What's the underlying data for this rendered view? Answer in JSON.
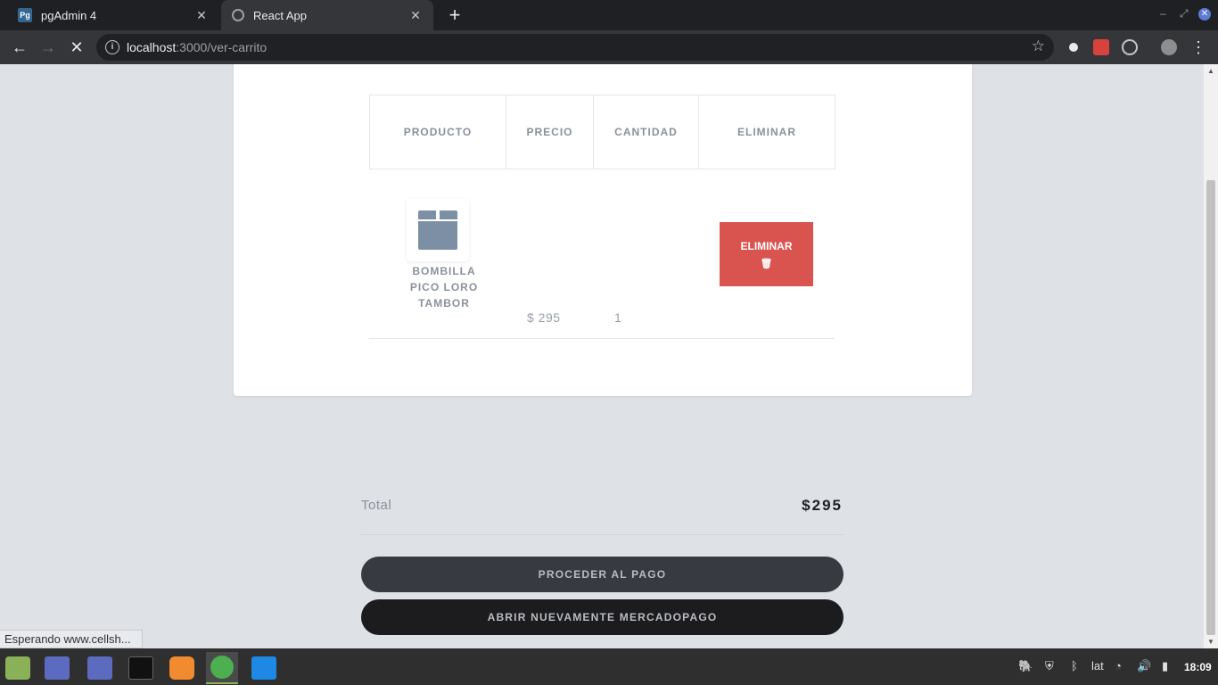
{
  "browser": {
    "tabs": [
      {
        "title": "pgAdmin 4",
        "favicon": "Pg"
      },
      {
        "title": "React App"
      }
    ],
    "url_host": "localhost",
    "url_path": ":3000/ver-carrito"
  },
  "cart": {
    "headers": [
      "PRODUCTO",
      "PRECIO",
      "CANTIDAD",
      "ELIMINAR"
    ],
    "item": {
      "name": "BOMBILLA PICO LORO TAMBOR",
      "price": "$ 295",
      "quantity": "1",
      "delete_label": "ELIMINAR"
    }
  },
  "summary": {
    "total_label": "Total",
    "total_value": "$295",
    "pay_label": "PROCEDER AL PAGO",
    "mercadopago_label": "ABRIR NUEVAMENTE MERCADOPAGO"
  },
  "status_text": "Esperando www.cellsh...",
  "taskbar": {
    "keyboard_layout": "lat",
    "clock": "18:09"
  },
  "colors": {
    "danger": "#d9534f",
    "page_bg": "#dee1e5",
    "pay_button": "#373a41",
    "mercadopago_button": "#1c1c1e"
  }
}
